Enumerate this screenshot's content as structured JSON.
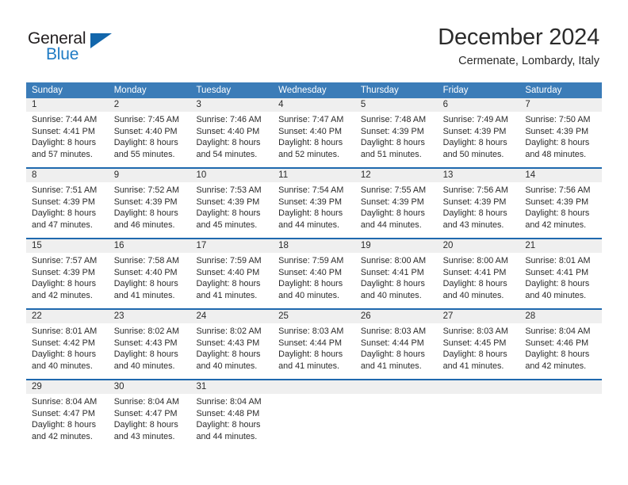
{
  "brand": {
    "name_part1": "General",
    "name_part2": "Blue",
    "triangle_color": "#1266ab",
    "text_color": "#231f20",
    "blue_color": "#1f7bc4"
  },
  "header": {
    "month_title": "December 2024",
    "location": "Cermenate, Lombardy, Italy"
  },
  "theme": {
    "header_row_bg": "#3b7cb8",
    "week_divider": "#1f69ae",
    "day_number_bg": "#efefef",
    "text": "#2b2b2b"
  },
  "weekdays": [
    "Sunday",
    "Monday",
    "Tuesday",
    "Wednesday",
    "Thursday",
    "Friday",
    "Saturday"
  ],
  "weeks": [
    [
      {
        "day": "1",
        "sunrise": "Sunrise: 7:44 AM",
        "sunset": "Sunset: 4:41 PM",
        "daylight1": "Daylight: 8 hours",
        "daylight2": "and 57 minutes."
      },
      {
        "day": "2",
        "sunrise": "Sunrise: 7:45 AM",
        "sunset": "Sunset: 4:40 PM",
        "daylight1": "Daylight: 8 hours",
        "daylight2": "and 55 minutes."
      },
      {
        "day": "3",
        "sunrise": "Sunrise: 7:46 AM",
        "sunset": "Sunset: 4:40 PM",
        "daylight1": "Daylight: 8 hours",
        "daylight2": "and 54 minutes."
      },
      {
        "day": "4",
        "sunrise": "Sunrise: 7:47 AM",
        "sunset": "Sunset: 4:40 PM",
        "daylight1": "Daylight: 8 hours",
        "daylight2": "and 52 minutes."
      },
      {
        "day": "5",
        "sunrise": "Sunrise: 7:48 AM",
        "sunset": "Sunset: 4:39 PM",
        "daylight1": "Daylight: 8 hours",
        "daylight2": "and 51 minutes."
      },
      {
        "day": "6",
        "sunrise": "Sunrise: 7:49 AM",
        "sunset": "Sunset: 4:39 PM",
        "daylight1": "Daylight: 8 hours",
        "daylight2": "and 50 minutes."
      },
      {
        "day": "7",
        "sunrise": "Sunrise: 7:50 AM",
        "sunset": "Sunset: 4:39 PM",
        "daylight1": "Daylight: 8 hours",
        "daylight2": "and 48 minutes."
      }
    ],
    [
      {
        "day": "8",
        "sunrise": "Sunrise: 7:51 AM",
        "sunset": "Sunset: 4:39 PM",
        "daylight1": "Daylight: 8 hours",
        "daylight2": "and 47 minutes."
      },
      {
        "day": "9",
        "sunrise": "Sunrise: 7:52 AM",
        "sunset": "Sunset: 4:39 PM",
        "daylight1": "Daylight: 8 hours",
        "daylight2": "and 46 minutes."
      },
      {
        "day": "10",
        "sunrise": "Sunrise: 7:53 AM",
        "sunset": "Sunset: 4:39 PM",
        "daylight1": "Daylight: 8 hours",
        "daylight2": "and 45 minutes."
      },
      {
        "day": "11",
        "sunrise": "Sunrise: 7:54 AM",
        "sunset": "Sunset: 4:39 PM",
        "daylight1": "Daylight: 8 hours",
        "daylight2": "and 44 minutes."
      },
      {
        "day": "12",
        "sunrise": "Sunrise: 7:55 AM",
        "sunset": "Sunset: 4:39 PM",
        "daylight1": "Daylight: 8 hours",
        "daylight2": "and 44 minutes."
      },
      {
        "day": "13",
        "sunrise": "Sunrise: 7:56 AM",
        "sunset": "Sunset: 4:39 PM",
        "daylight1": "Daylight: 8 hours",
        "daylight2": "and 43 minutes."
      },
      {
        "day": "14",
        "sunrise": "Sunrise: 7:56 AM",
        "sunset": "Sunset: 4:39 PM",
        "daylight1": "Daylight: 8 hours",
        "daylight2": "and 42 minutes."
      }
    ],
    [
      {
        "day": "15",
        "sunrise": "Sunrise: 7:57 AM",
        "sunset": "Sunset: 4:39 PM",
        "daylight1": "Daylight: 8 hours",
        "daylight2": "and 42 minutes."
      },
      {
        "day": "16",
        "sunrise": "Sunrise: 7:58 AM",
        "sunset": "Sunset: 4:40 PM",
        "daylight1": "Daylight: 8 hours",
        "daylight2": "and 41 minutes."
      },
      {
        "day": "17",
        "sunrise": "Sunrise: 7:59 AM",
        "sunset": "Sunset: 4:40 PM",
        "daylight1": "Daylight: 8 hours",
        "daylight2": "and 41 minutes."
      },
      {
        "day": "18",
        "sunrise": "Sunrise: 7:59 AM",
        "sunset": "Sunset: 4:40 PM",
        "daylight1": "Daylight: 8 hours",
        "daylight2": "and 40 minutes."
      },
      {
        "day": "19",
        "sunrise": "Sunrise: 8:00 AM",
        "sunset": "Sunset: 4:41 PM",
        "daylight1": "Daylight: 8 hours",
        "daylight2": "and 40 minutes."
      },
      {
        "day": "20",
        "sunrise": "Sunrise: 8:00 AM",
        "sunset": "Sunset: 4:41 PM",
        "daylight1": "Daylight: 8 hours",
        "daylight2": "and 40 minutes."
      },
      {
        "day": "21",
        "sunrise": "Sunrise: 8:01 AM",
        "sunset": "Sunset: 4:41 PM",
        "daylight1": "Daylight: 8 hours",
        "daylight2": "and 40 minutes."
      }
    ],
    [
      {
        "day": "22",
        "sunrise": "Sunrise: 8:01 AM",
        "sunset": "Sunset: 4:42 PM",
        "daylight1": "Daylight: 8 hours",
        "daylight2": "and 40 minutes."
      },
      {
        "day": "23",
        "sunrise": "Sunrise: 8:02 AM",
        "sunset": "Sunset: 4:43 PM",
        "daylight1": "Daylight: 8 hours",
        "daylight2": "and 40 minutes."
      },
      {
        "day": "24",
        "sunrise": "Sunrise: 8:02 AM",
        "sunset": "Sunset: 4:43 PM",
        "daylight1": "Daylight: 8 hours",
        "daylight2": "and 40 minutes."
      },
      {
        "day": "25",
        "sunrise": "Sunrise: 8:03 AM",
        "sunset": "Sunset: 4:44 PM",
        "daylight1": "Daylight: 8 hours",
        "daylight2": "and 41 minutes."
      },
      {
        "day": "26",
        "sunrise": "Sunrise: 8:03 AM",
        "sunset": "Sunset: 4:44 PM",
        "daylight1": "Daylight: 8 hours",
        "daylight2": "and 41 minutes."
      },
      {
        "day": "27",
        "sunrise": "Sunrise: 8:03 AM",
        "sunset": "Sunset: 4:45 PM",
        "daylight1": "Daylight: 8 hours",
        "daylight2": "and 41 minutes."
      },
      {
        "day": "28",
        "sunrise": "Sunrise: 8:04 AM",
        "sunset": "Sunset: 4:46 PM",
        "daylight1": "Daylight: 8 hours",
        "daylight2": "and 42 minutes."
      }
    ],
    [
      {
        "day": "29",
        "sunrise": "Sunrise: 8:04 AM",
        "sunset": "Sunset: 4:47 PM",
        "daylight1": "Daylight: 8 hours",
        "daylight2": "and 42 minutes."
      },
      {
        "day": "30",
        "sunrise": "Sunrise: 8:04 AM",
        "sunset": "Sunset: 4:47 PM",
        "daylight1": "Daylight: 8 hours",
        "daylight2": "and 43 minutes."
      },
      {
        "day": "31",
        "sunrise": "Sunrise: 8:04 AM",
        "sunset": "Sunset: 4:48 PM",
        "daylight1": "Daylight: 8 hours",
        "daylight2": "and 44 minutes."
      },
      {
        "day": "",
        "sunrise": "",
        "sunset": "",
        "daylight1": "",
        "daylight2": ""
      },
      {
        "day": "",
        "sunrise": "",
        "sunset": "",
        "daylight1": "",
        "daylight2": ""
      },
      {
        "day": "",
        "sunrise": "",
        "sunset": "",
        "daylight1": "",
        "daylight2": ""
      },
      {
        "day": "",
        "sunrise": "",
        "sunset": "",
        "daylight1": "",
        "daylight2": ""
      }
    ]
  ]
}
